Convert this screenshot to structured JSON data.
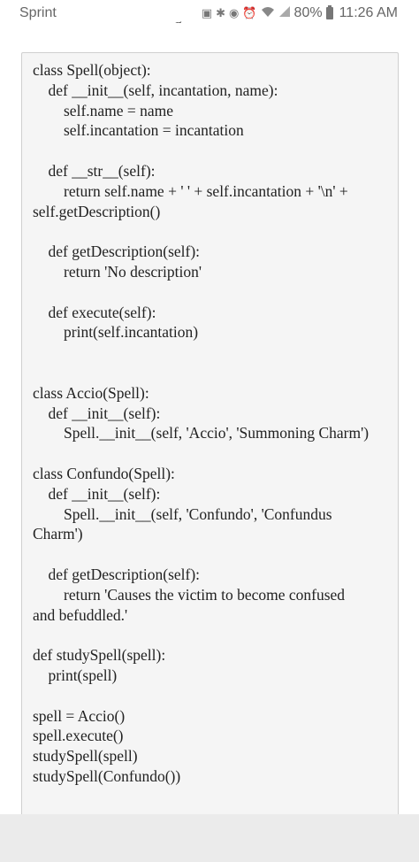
{
  "status_bar": {
    "carrier": "Sprint",
    "battery": "80%",
    "time": "11:26 AM",
    "icons": [
      "photo-icon",
      "bluetooth-icon",
      "voicemail-icon",
      "alarm-icon",
      "wifi-icon",
      "signal-icon",
      "battery-icon"
    ]
  },
  "page": {
    "heading_fragment": "g"
  },
  "code": {
    "lines": [
      "class Spell(object):",
      "    def __init__(self, incantation, name):",
      "        self.name = name",
      "        self.incantation = incantation",
      "",
      "    def __str__(self):",
      "        return self.name + ' ' + self.incantation + '\\n' +",
      "self.getDescription()",
      "",
      "    def getDescription(self):",
      "        return 'No description'",
      "",
      "    def execute(self):",
      "        print(self.incantation)",
      "",
      "",
      "class Accio(Spell):",
      "    def __init__(self):",
      "        Spell.__init__(self, 'Accio', 'Summoning Charm')",
      "",
      "class Confundo(Spell):",
      "    def __init__(self):",
      "        Spell.__init__(self, 'Confundo', 'Confundus",
      "Charm')",
      "",
      "    def getDescription(self):",
      "        return 'Causes the victim to become confused",
      "and befuddled.'",
      "",
      "def studySpell(spell):",
      "    print(spell)",
      "",
      "spell = Accio()",
      "spell.execute()",
      "studySpell(spell)",
      "studySpell(Confundo())"
    ]
  }
}
